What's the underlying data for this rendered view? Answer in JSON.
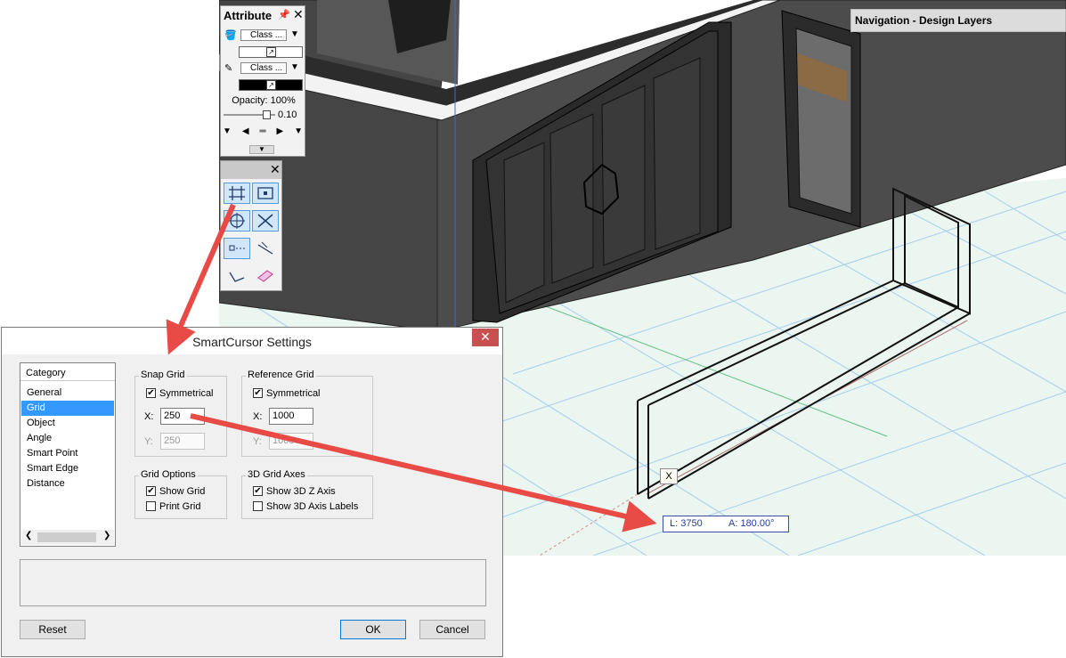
{
  "attribute_palette": {
    "title": "Attribute",
    "fill_class": "Class ...",
    "pen_class": "Class ...",
    "opacity": "Opacity: 100%",
    "line_weight": "0.10"
  },
  "navigation_palette": {
    "title": "Navigation - Design Layers"
  },
  "dialog": {
    "title": "SmartCursor Settings",
    "category_header": "Category",
    "categories": [
      "General",
      "Grid",
      "Object",
      "Angle",
      "Smart Point",
      "Smart Edge",
      "Distance"
    ],
    "selected_category": "Grid",
    "snap_grid": {
      "label": "Snap Grid",
      "symmetrical_label": "Symmetrical",
      "symmetrical": true,
      "x_label": "X:",
      "x_value": "250",
      "y_label": "Y:",
      "y_value": "250"
    },
    "reference_grid": {
      "label": "Reference Grid",
      "symmetrical_label": "Symmetrical",
      "symmetrical": true,
      "x_label": "X:",
      "x_value": "1000",
      "y_label": "Y:",
      "y_value": "1000"
    },
    "grid_options": {
      "label": "Grid Options",
      "show_grid_label": "Show Grid",
      "show_grid": true,
      "print_grid_label": "Print Grid",
      "print_grid": false
    },
    "grid_axes_3d": {
      "label": "3D Grid Axes",
      "show_z_label": "Show 3D Z Axis",
      "show_z": true,
      "show_labels_label": "Show 3D Axis Labels",
      "show_labels": false
    },
    "buttons": {
      "reset": "Reset",
      "ok": "OK",
      "cancel": "Cancel"
    }
  },
  "cursor_readout": {
    "length": "L:  3750",
    "angle": "A:  180.00°"
  },
  "snap_tag": "X",
  "colors": {
    "annotation_arrow": "#e84b45",
    "selection": "#3399ff",
    "close_button": "#c75050",
    "readout_text": "#1f3fa0",
    "grid_line": "#9ec9ee",
    "ground": "#e9f6ee",
    "wall": "#4a4a4a"
  }
}
